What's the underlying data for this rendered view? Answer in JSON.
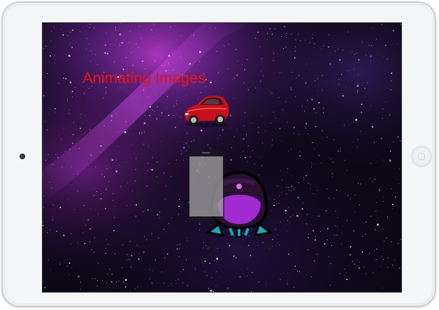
{
  "app": {
    "title": "Animating Images"
  },
  "scene": {
    "images": [
      {
        "name": "car",
        "icon": "red-sports-car"
      },
      {
        "name": "phone",
        "icon": "translucent-phone"
      },
      {
        "name": "rocket",
        "icon": "purple-rocket"
      }
    ]
  },
  "colors": {
    "title": "#e01616",
    "background": "#0a0612",
    "nebula": "#a02bd0"
  }
}
